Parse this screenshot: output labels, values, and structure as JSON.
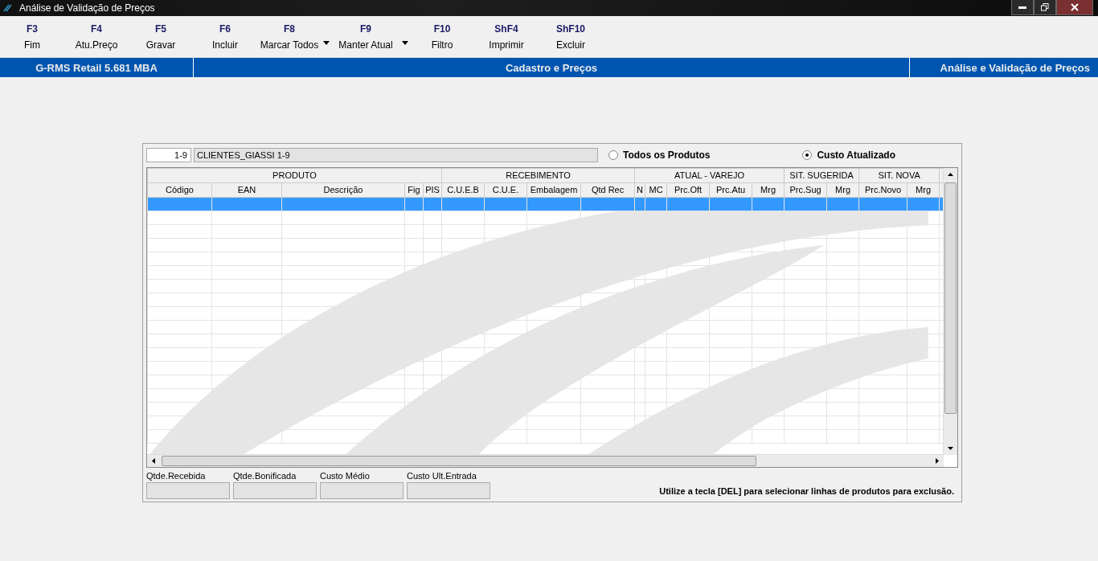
{
  "window": {
    "title": "Análise de Validação de Preços"
  },
  "toolbar": [
    {
      "key": "F3",
      "label": "Fim",
      "dropdown": false
    },
    {
      "key": "F4",
      "label": "Atu.Preço",
      "dropdown": false
    },
    {
      "key": "F5",
      "label": "Gravar",
      "dropdown": false
    },
    {
      "key": "F6",
      "label": "Incluir",
      "dropdown": false
    },
    {
      "key": "F8",
      "label": "Marcar Todos",
      "dropdown": true
    },
    {
      "key": "F9",
      "label": "Manter Atual",
      "dropdown": true
    },
    {
      "key": "F10",
      "label": "Filtro",
      "dropdown": false
    },
    {
      "key": "ShF4",
      "label": "Imprimir",
      "dropdown": false
    },
    {
      "key": "ShF10",
      "label": "Excluir",
      "dropdown": false
    }
  ],
  "header_bar": {
    "left": "G-RMS Retail 5.681 MBA",
    "center": "Cadastro e Preços",
    "right": "Análise e Validação de Preços"
  },
  "filter": {
    "code": "1-9",
    "name": "CLIENTES_GIASSI 1-9"
  },
  "radios": [
    {
      "label": "Todos os Produtos",
      "selected": false
    },
    {
      "label": "Custo Atualizado",
      "selected": true
    }
  ],
  "table": {
    "groups": [
      {
        "label": "PRODUTO"
      },
      {
        "label": "RECEBIMENTO"
      },
      {
        "label": "ATUAL - VAREJO"
      },
      {
        "label": "SIT. SUGERIDA"
      },
      {
        "label": "SIT. NOVA"
      }
    ],
    "columns": [
      "Código",
      "EAN",
      "Descrição",
      "Fig",
      "PIS",
      "C.U.E.B",
      "C.U.E.",
      "Embalagem",
      "Qtd Rec",
      "N",
      "MC",
      "Prc.Oft",
      "Prc.Atu",
      "Mrg",
      "Prc.Sug",
      "Mrg",
      "Prc.Novo",
      "Mrg"
    ],
    "rows": [
      {
        "selected": true
      },
      {
        "selected": false
      },
      {
        "selected": false
      },
      {
        "selected": false
      },
      {
        "selected": false
      },
      {
        "selected": false
      },
      {
        "selected": false
      },
      {
        "selected": false
      },
      {
        "selected": false
      },
      {
        "selected": false
      },
      {
        "selected": false
      },
      {
        "selected": false
      },
      {
        "selected": false
      },
      {
        "selected": false
      },
      {
        "selected": false
      },
      {
        "selected": false
      },
      {
        "selected": false
      },
      {
        "selected": false
      }
    ]
  },
  "totals": [
    {
      "label": "Qtde.Recebida"
    },
    {
      "label": "Qtde.Bonificada"
    },
    {
      "label": "Custo Médio"
    },
    {
      "label": "Custo Ult.Entrada"
    }
  ],
  "hint": "Utilize a tecla [DEL] para selecionar linhas de produtos para exclusão."
}
